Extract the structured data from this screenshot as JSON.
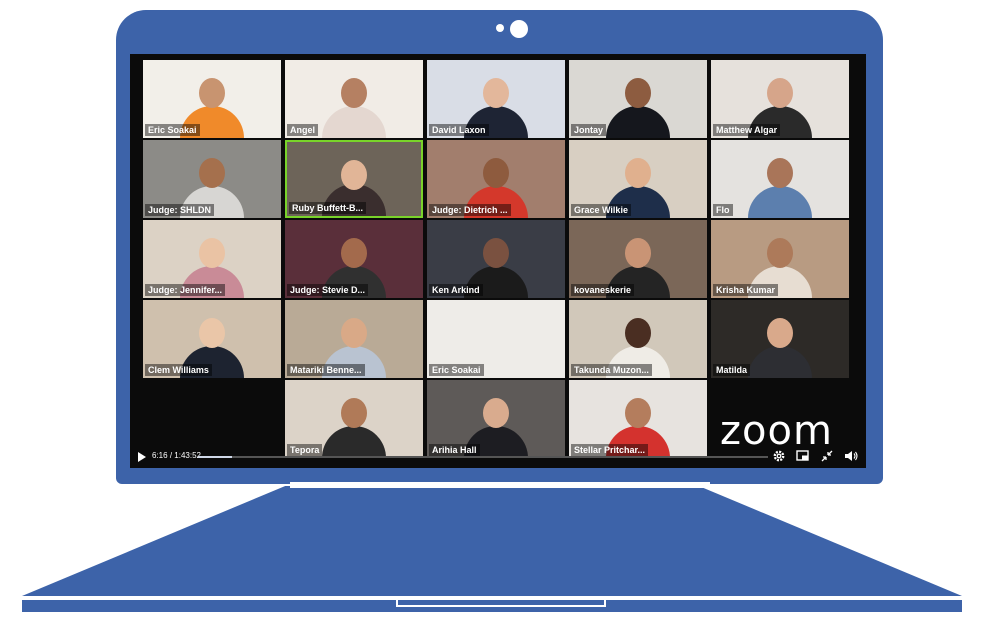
{
  "participants": [
    {
      "name": "Eric Soakai",
      "wall": "#f2efe9",
      "shirt": "#f08a2a",
      "skin": "#c89470"
    },
    {
      "name": "Angel",
      "wall": "#f1ece6",
      "shirt": "#e4d7d0",
      "skin": "#b58062"
    },
    {
      "name": "David Laxon",
      "wall": "#d9dde6",
      "shirt": "#1e2434",
      "skin": "#e3b79b"
    },
    {
      "name": "Jontay",
      "wall": "#dad8d3",
      "shirt": "#15171d",
      "skin": "#8d5c40"
    },
    {
      "name": "Matthew Algar",
      "wall": "#e6e1dc",
      "shirt": "#2a2a2a",
      "skin": "#d6a58a"
    },
    {
      "name": "Judge: SHLDN",
      "wall": "#8c8b87",
      "shirt": "#d7d6d3",
      "skin": "#a5704d"
    },
    {
      "name": "Ruby Buffett-B...",
      "wall": "#6d6459",
      "shirt": "#3a2e2e",
      "skin": "#e1b597",
      "active": true
    },
    {
      "name": "Judge: Dietrich ...",
      "wall": "#a27e6d",
      "shirt": "#d4382b",
      "skin": "#8e5b3e"
    },
    {
      "name": "Grace Wilkie",
      "wall": "#d8cfc2",
      "shirt": "#1e2e4a",
      "skin": "#e0b08e"
    },
    {
      "name": "Flo",
      "wall": "#e4e2df",
      "shirt": "#5c7fae",
      "skin": "#a97559"
    },
    {
      "name": "Judge: Jennifer...",
      "wall": "#dcd2c5",
      "shirt": "#c98b97",
      "skin": "#eac3a4"
    },
    {
      "name": "Judge: Stevie D...",
      "wall": "#5a2f3a",
      "shirt": "#303030",
      "skin": "#a36a4c"
    },
    {
      "name": "Ken Arkind",
      "wall": "#3a3d46",
      "shirt": "#1b1b1b",
      "skin": "#7a5140"
    },
    {
      "name": "kovaneskerie",
      "wall": "#7b6758",
      "shirt": "#242424",
      "skin": "#c99475"
    },
    {
      "name": "Krisha Kumar",
      "wall": "#b89b82",
      "shirt": "#e7ddd2",
      "skin": "#ad7a5a"
    },
    {
      "name": "Clem Williams",
      "wall": "#cfc0ad",
      "shirt": "#1d2330",
      "skin": "#eac6a8"
    },
    {
      "name": "Matariki Benne...",
      "wall": "#b9aa96",
      "shirt": "#b9c3d1",
      "skin": "#d9a987"
    },
    {
      "name": "Eric Soakai",
      "wall": "#eeece8",
      "shirt": "#eeece8",
      "skin": "#eeece8",
      "empty": true
    },
    {
      "name": "Takunda Muzon...",
      "wall": "#d1c8ba",
      "shirt": "#efece6",
      "skin": "#4a2e22"
    },
    {
      "name": "Matilda",
      "wall": "#2d2a27",
      "shirt": "#2d2e33",
      "skin": "#d9a98b"
    },
    {
      "name": "",
      "wall": "#0b0b0b",
      "shirt": "#0b0b0b",
      "skin": "#0b0b0b",
      "empty": true,
      "blank": true
    },
    {
      "name": "Tepora",
      "wall": "#dcd3c8",
      "shirt": "#2a2a2a",
      "skin": "#b07a58"
    },
    {
      "name": "Arihia Hall",
      "wall": "#5e5a58",
      "shirt": "#1d1d22",
      "skin": "#d9ab8e"
    },
    {
      "name": "Stellar Pritchar...",
      "wall": "#e7e3df",
      "shirt": "#d4322e",
      "skin": "#b47d5d"
    }
  ],
  "logo": "zoom",
  "player": {
    "elapsed": "6:16",
    "total": "1:43:52",
    "progress": 0.06
  },
  "icons": {
    "play": "play-icon",
    "settings": "gear-icon",
    "pip": "picture-in-picture-icon",
    "fullscreen": "collapse-icon",
    "volume": "volume-icon"
  }
}
